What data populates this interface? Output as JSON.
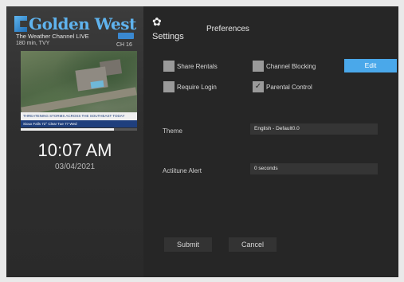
{
  "channel": {
    "logo_text": "Golden West",
    "name": "The Weather Channel LIVE",
    "subtitle": "180 min, TVY",
    "number": "CH 16"
  },
  "preview": {
    "lower_third": "THREATENING STORMS ACROSS THE SOUTHEAST TODAY",
    "ticker": "Sioux Falls  72°  Clear  Tue  77  Wed",
    "progress": 0.8
  },
  "clock": {
    "time": "10:07 AM",
    "date": "03/04/2021"
  },
  "header": {
    "settings_label": "Settings",
    "title": "Preferences"
  },
  "options": {
    "share_rentals": {
      "label": "Share Rentals",
      "checked": false
    },
    "channel_blocking": {
      "label": "Channel Blocking",
      "checked": false
    },
    "require_login": {
      "label": "Require Login",
      "checked": false
    },
    "parental_control": {
      "label": "Parental Control",
      "checked": true
    }
  },
  "edit_label": "Edit",
  "fields": {
    "theme": {
      "label": "Theme",
      "value": "English - Default0.0"
    },
    "actiitune_alert": {
      "label": "Actiitune Alert",
      "value": "0 seconds"
    }
  },
  "buttons": {
    "submit": "Submit",
    "cancel": "Cancel"
  },
  "colors": {
    "accent": "#4aa8ea",
    "background": "#262626",
    "checkbox": "#9a9a9a"
  },
  "icons": {
    "settings": "gear-icon",
    "check": "checkmark-icon"
  }
}
